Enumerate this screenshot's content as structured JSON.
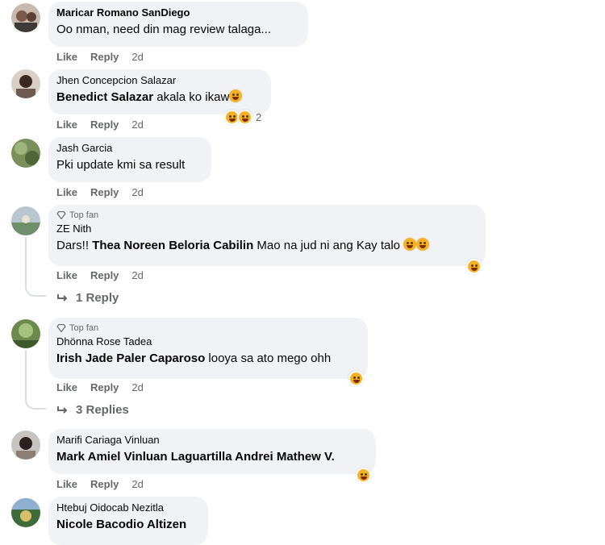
{
  "labels": {
    "like": "Like",
    "reply": "Reply",
    "top_fan": "Top fan"
  },
  "comments": [
    {
      "author": "Maricar Romano SanDiego",
      "text": "Oo nman, need din mag review talaga...",
      "time": "2d"
    },
    {
      "author": "Jhen Concepcion Salazar",
      "mention": "Benedict Salazar",
      "text": " akala ko ikaw",
      "time": "2d",
      "reaction_count": "2"
    },
    {
      "author": "Jash Garcia",
      "text": "Pki update kmi sa result",
      "time": "2d"
    },
    {
      "author": "ZE Nith",
      "top_fan": true,
      "pre": "Dars!! ",
      "mention": "Thea Noreen Beloria Cabilin",
      "text": " Mao na jud ni ang Kay talo",
      "time": "2d",
      "replies": "1 Reply"
    },
    {
      "author": "Dhönna Rose Tadea",
      "top_fan": true,
      "mention": "Irish Jade Paler Caparoso",
      "text": " looya sa ato mego ohh",
      "time": "2d",
      "replies": "3 Replies"
    },
    {
      "author": "Marifi Cariaga Vinluan",
      "mention": "Mark Amiel Vinluan Laguartilla Andrei Mathew V.",
      "text": "",
      "time": "2d"
    },
    {
      "author": "Htebuj Oidocab Nezitla",
      "mention": "Nicole Bacodio Altizen",
      "text": ""
    }
  ]
}
